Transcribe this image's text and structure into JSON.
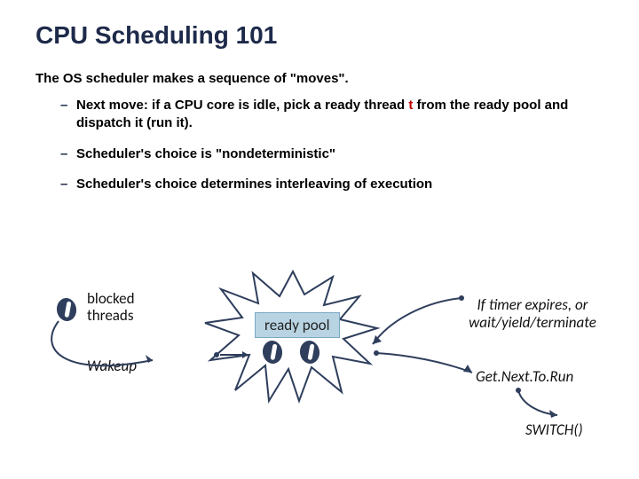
{
  "title": "CPU Scheduling 101",
  "intro": "The OS scheduler makes a sequence of \"moves\".",
  "bullets": {
    "b1_pre": "Next move: if a CPU core is idle, pick a ready thread ",
    "b1_red": "t",
    "b1_post": " from the ready pool and dispatch it (run it).",
    "b2": "Scheduler's choice is \"nondeterministic\"",
    "b3": "Scheduler's choice determines interleaving of execution"
  },
  "diagram": {
    "blocked": "blocked threads",
    "wakeup": "Wakeup",
    "ready": "ready pool",
    "timer": "If timer expires, or wait/yield/terminate",
    "getnext": "Get.Next.To.Run",
    "switch": "SWITCH()"
  }
}
